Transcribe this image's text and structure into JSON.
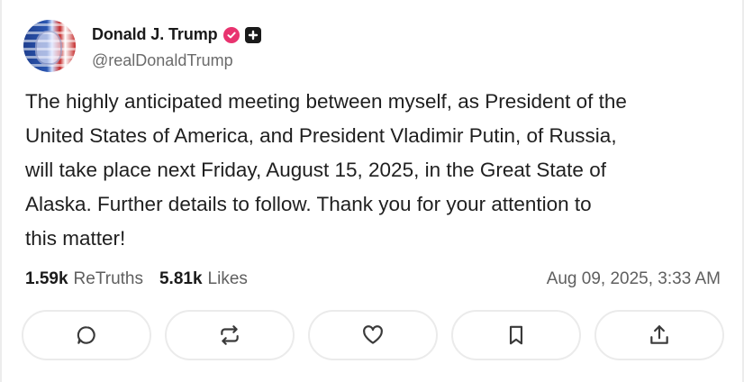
{
  "author": {
    "display_name": "Donald J. Trump",
    "handle": "@realDonaldTrump",
    "verified_color": "#e8336f"
  },
  "post": {
    "lines": [
      "The highly anticipated meeting between myself, as President of the",
      "United States of America, and President Vladimir Putin, of Russia,",
      "will take place next Friday, August 15, 2025, in the Great State of",
      "Alaska. Further details to follow. Thank you for your attention to",
      "this matter!"
    ]
  },
  "stats": {
    "retruths_count": "1.59k",
    "retruths_label": "ReTruths",
    "likes_count": "5.81k",
    "likes_label": "Likes",
    "timestamp": "Aug 09, 2025, 3:33 AM"
  },
  "actions": [
    {
      "icon": "reply-icon"
    },
    {
      "icon": "retruth-icon"
    },
    {
      "icon": "heart-icon"
    },
    {
      "icon": "bookmark-icon"
    },
    {
      "icon": "share-icon"
    }
  ]
}
